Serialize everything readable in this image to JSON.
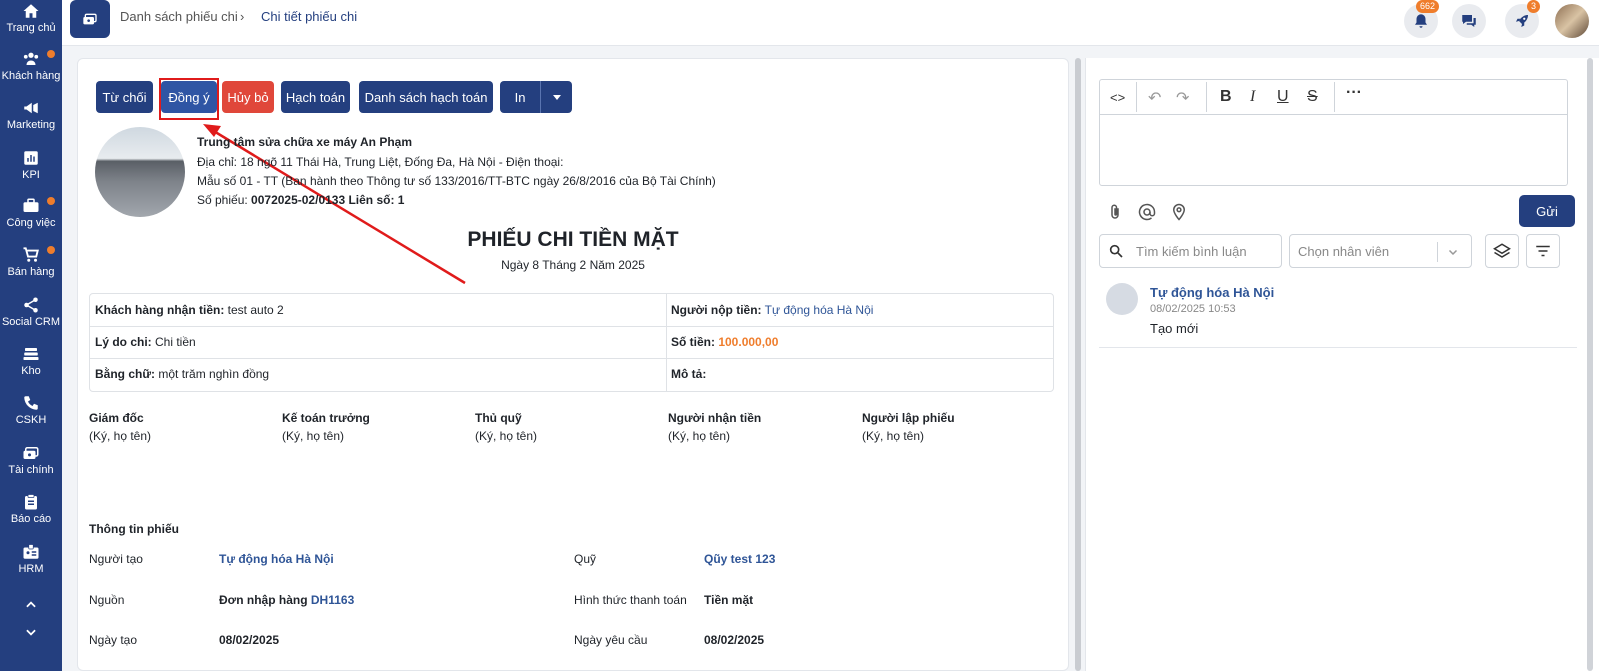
{
  "sidebar": {
    "items": [
      {
        "label": "Trang chủ",
        "icon": "home-icon",
        "dot": false
      },
      {
        "label": "Khách hàng",
        "icon": "users-icon",
        "dot": true
      },
      {
        "label": "Marketing",
        "icon": "megaphone-icon",
        "dot": false
      },
      {
        "label": "KPI",
        "icon": "chart-icon",
        "dot": false
      },
      {
        "label": "Công việc",
        "icon": "briefcase-icon",
        "dot": true
      },
      {
        "label": "Bán hàng",
        "icon": "cart-icon",
        "dot": true
      },
      {
        "label": "Social CRM",
        "icon": "share-icon",
        "dot": false
      },
      {
        "label": "Kho",
        "icon": "warehouse-icon",
        "dot": false
      },
      {
        "label": "CSKH",
        "icon": "phone-icon",
        "dot": false
      },
      {
        "label": "Tài chính",
        "icon": "money-icon",
        "dot": false
      },
      {
        "label": "Báo cáo",
        "icon": "clipboard-icon",
        "dot": false
      },
      {
        "label": "HRM",
        "icon": "id-card-icon",
        "dot": false
      }
    ]
  },
  "header": {
    "breadcrumb_1": "Danh sách phiếu chi",
    "breadcrumb_2": "Chi tiết phiếu chi",
    "notification_count": "662",
    "rocket_count": "3"
  },
  "toolbar": {
    "reject": "Từ chối",
    "approve": "Đồng ý",
    "cancel": "Hủy bỏ",
    "account": "Hạch toán",
    "account_list": "Danh sách hạch toán",
    "print": "In"
  },
  "company": {
    "name": "Trung tâm sửa chữa xe máy An Phạm",
    "address": "Địa chỉ: 18 ngõ 11 Thái Hà, Trung Liệt, Đống Đa, Hà Nội - Điện thoại:",
    "form": "Mẫu số 01 - TT (Ban hành theo Thông tư số 133/2016/TT-BTC ngày 26/8/2016 của Bộ Tài Chính)",
    "voucher_label": "Số phiếu: ",
    "voucher_no": "0072025-02/0133 Liên số: 1"
  },
  "doc": {
    "title": "PHIẾU CHI TIỀN MẶT",
    "date": "Ngày 8 Tháng 2 Năm 2025"
  },
  "table": {
    "receiver_label": "Khách hàng nhận tiền:",
    "receiver_value": " test auto 2",
    "payer_label": "Người nộp tiền:",
    "payer_value": " Tự động hóa Hà Nội",
    "reason_label": "Lý do chi:",
    "reason_value": " Chi tiền",
    "amount_label": "Số tiền:",
    "amount_value": " 100.000,00",
    "words_label": "Bằng chữ:",
    "words_value": " một trăm nghìn đồng",
    "desc_label": "Mô tả:"
  },
  "signatures": [
    {
      "role": "Giám đốc",
      "note": "(Ký, họ tên)"
    },
    {
      "role": "Kế toán trưởng",
      "note": "(Ký, họ tên)"
    },
    {
      "role": "Thủ quỹ",
      "note": "(Ký, họ tên)"
    },
    {
      "role": "Người nhận tiền",
      "note": "(Ký, họ tên)"
    },
    {
      "role": "Người lập phiếu",
      "note": "(Ký, họ tên)"
    }
  ],
  "voucher_info": {
    "section_title": "Thông tin phiếu",
    "creator_label": "Người tạo",
    "creator_value": "Tự động hóa Hà Nội",
    "fund_label": "Quỹ",
    "fund_value": "Qũy test 123",
    "source_label": "Nguồn",
    "source_value": "Đơn nhập hàng",
    "source_code": "DH1163",
    "payment_label": "Hình thức thanh toán",
    "payment_value": "Tiền mặt",
    "created_label": "Ngày tạo",
    "created_value": "08/02/2025",
    "requested_label": "Ngày yêu cầu",
    "requested_value": "08/02/2025"
  },
  "comments": {
    "send": "Gửi",
    "search_placeholder": "Tìm kiếm bình luận",
    "staff_placeholder": "Chọn nhân viên",
    "items": [
      {
        "author": "Tự động hóa Hà Nội",
        "time": "08/02/2025 10:53",
        "text": "Tạo mới"
      }
    ]
  },
  "colors": {
    "primary": "#243f7f",
    "danger": "#e0473a",
    "badge": "#ef7d2c",
    "amount": "#ef7d2c"
  }
}
